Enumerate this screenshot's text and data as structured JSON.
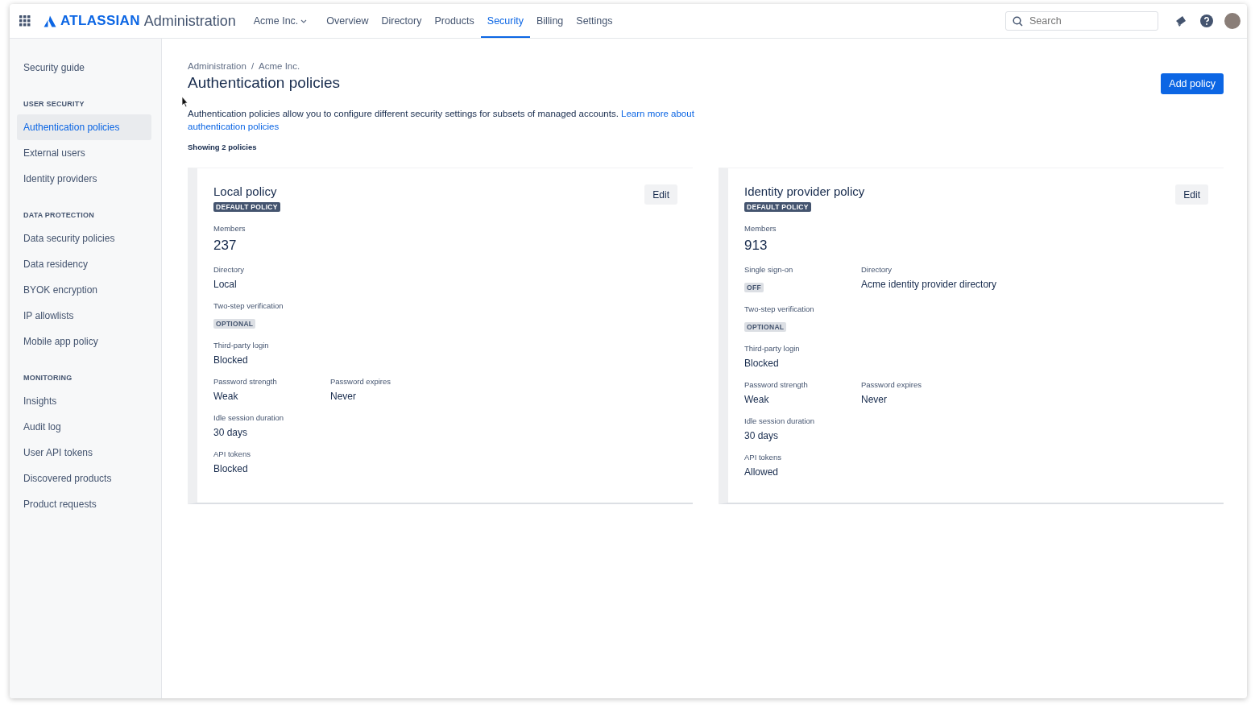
{
  "top_nav": {
    "product_name": "ATLASSIAN",
    "app_name": "Administration",
    "org_switcher": "Acme Inc.",
    "items": [
      {
        "label": "Overview",
        "selected": false
      },
      {
        "label": "Directory",
        "selected": false
      },
      {
        "label": "Products",
        "selected": false
      },
      {
        "label": "Security",
        "selected": true
      },
      {
        "label": "Billing",
        "selected": false
      },
      {
        "label": "Settings",
        "selected": false
      }
    ],
    "search": {
      "placeholder": "Search"
    }
  },
  "sidebar": {
    "sections": [
      {
        "items": [
          {
            "label": "Security guide",
            "selected": false
          }
        ]
      },
      {
        "heading": "USER SECURITY",
        "items": [
          {
            "label": "Authentication policies",
            "selected": true
          },
          {
            "label": "External users",
            "selected": false
          },
          {
            "label": "Identity providers",
            "selected": false
          }
        ]
      },
      {
        "heading": "DATA PROTECTION",
        "items": [
          {
            "label": "Data security policies",
            "selected": false
          },
          {
            "label": "Data residency",
            "selected": false
          },
          {
            "label": "BYOK encryption",
            "selected": false
          },
          {
            "label": "IP allowlists",
            "selected": false
          },
          {
            "label": "Mobile app policy",
            "selected": false
          }
        ]
      },
      {
        "heading": "MONITORING",
        "items": [
          {
            "label": "Insights",
            "selected": false
          },
          {
            "label": "Audit log",
            "selected": false
          },
          {
            "label": "User API tokens",
            "selected": false
          },
          {
            "label": "Discovered products",
            "selected": false
          },
          {
            "label": "Product requests",
            "selected": false
          }
        ]
      }
    ]
  },
  "page": {
    "breadcrumbs": [
      "Administration",
      "Acme Inc."
    ],
    "breadcrumb_separator": "/",
    "title": "Authentication policies",
    "primary_button": "Add policy",
    "description": "Authentication policies allow you to configure different security settings for subsets of managed accounts.",
    "description_link_lines": [
      "Learn more about",
      "authentication policies"
    ],
    "count_label": "Showing 2 policies"
  },
  "policies": [
    {
      "title": "Local policy",
      "badge": "DEFAULT POLICY",
      "edit_button": "Edit",
      "rows": [
        [
          {
            "label": "Members",
            "value": "237",
            "kind": "count"
          }
        ],
        [
          {
            "label": "Directory",
            "value": "Local",
            "kind": "text"
          }
        ],
        [
          {
            "label": "Two-step verification",
            "value": "OPTIONAL",
            "kind": "lozenge"
          }
        ],
        [
          {
            "label": "Third-party login",
            "value": "Blocked",
            "kind": "text"
          }
        ],
        [
          {
            "label": "Password strength",
            "value": "Weak",
            "kind": "text"
          },
          {
            "label": "Password expires",
            "value": "Never",
            "kind": "text"
          }
        ],
        [
          {
            "label": "Idle session duration",
            "value": "30 days",
            "kind": "text"
          }
        ],
        [
          {
            "label": "API tokens",
            "value": "Blocked",
            "kind": "text"
          }
        ]
      ]
    },
    {
      "title": "Identity provider policy",
      "badge": "DEFAULT POLICY",
      "edit_button": "Edit",
      "rows": [
        [
          {
            "label": "Members",
            "value": "913",
            "kind": "count"
          }
        ],
        [
          {
            "label": "Single sign-on",
            "value": "OFF",
            "kind": "lozenge"
          },
          {
            "label": "Directory",
            "value": "Acme identity provider directory",
            "kind": "text"
          }
        ],
        [
          {
            "label": "Two-step verification",
            "value": "OPTIONAL",
            "kind": "lozenge"
          }
        ],
        [
          {
            "label": "Third-party login",
            "value": "Blocked",
            "kind": "text"
          }
        ],
        [
          {
            "label": "Password strength",
            "value": "Weak",
            "kind": "text"
          },
          {
            "label": "Password expires",
            "value": "Never",
            "kind": "text"
          }
        ],
        [
          {
            "label": "Idle session duration",
            "value": "30 days",
            "kind": "text"
          }
        ],
        [
          {
            "label": "API tokens",
            "value": "Allowed",
            "kind": "text"
          }
        ]
      ]
    }
  ]
}
